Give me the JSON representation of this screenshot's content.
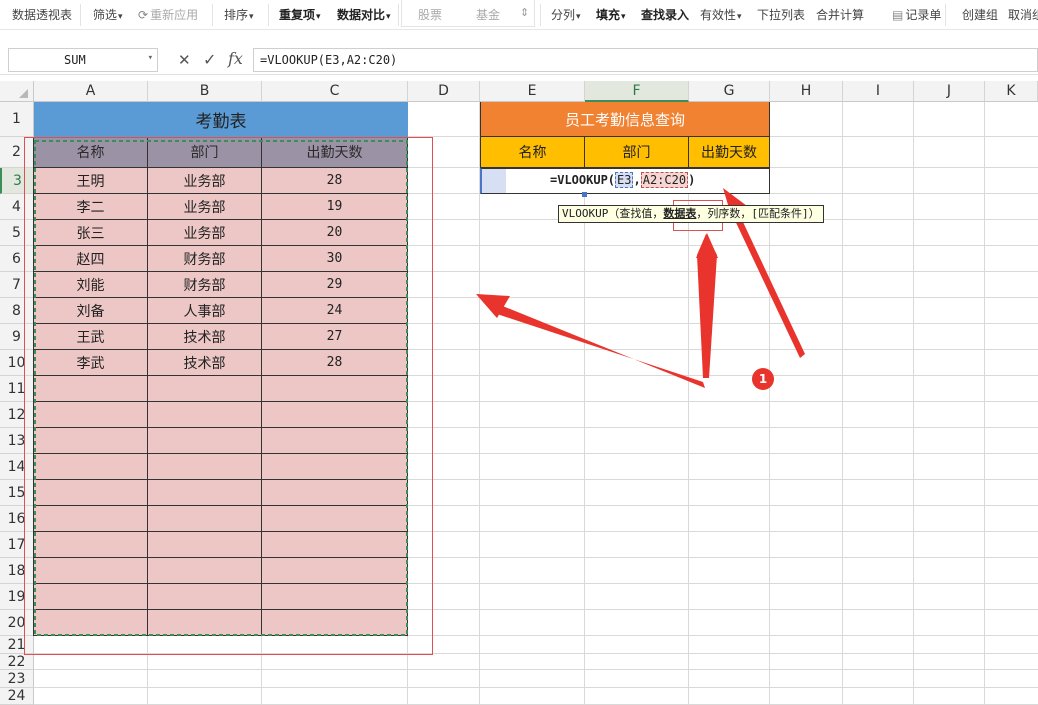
{
  "ribbon": {
    "items": [
      {
        "label": "数据透视表",
        "state": "normal"
      },
      {
        "label": "筛选",
        "state": "normal",
        "dropdown": true
      },
      {
        "label": "重新应用",
        "state": "dim"
      },
      {
        "label": "排序",
        "state": "normal",
        "dropdown": true
      },
      {
        "label": "重复项",
        "state": "bold",
        "dropdown": true
      },
      {
        "label": "数据对比",
        "state": "bold",
        "dropdown": true
      },
      {
        "label": "股票",
        "state": "dim"
      },
      {
        "label": "基金",
        "state": "dim"
      },
      {
        "label": "分列",
        "state": "normal",
        "dropdown": true
      },
      {
        "label": "填充",
        "state": "bold",
        "dropdown": true
      },
      {
        "label": "查找录入",
        "state": "bold"
      },
      {
        "label": "有效性",
        "state": "normal",
        "dropdown": true
      },
      {
        "label": "下拉列表",
        "state": "normal"
      },
      {
        "label": "合并计算",
        "state": "normal"
      },
      {
        "label": "记录单",
        "state": "normal"
      },
      {
        "label": "创建组",
        "state": "normal"
      },
      {
        "label": "取消组",
        "state": "normal"
      }
    ]
  },
  "formula_bar": {
    "name_box": "SUM",
    "cancel_symbol": "✕",
    "confirm_symbol": "✓",
    "fx_label": "fx",
    "formula": "=VLOOKUP(E3,A2:C20)"
  },
  "columns": [
    "A",
    "B",
    "C",
    "D",
    "E",
    "F",
    "G",
    "H",
    "I",
    "J",
    "K"
  ],
  "rows": [
    "1",
    "2",
    "3",
    "4",
    "5",
    "6",
    "7",
    "8",
    "9",
    "10",
    "11",
    "12",
    "13",
    "14",
    "15",
    "16",
    "17",
    "18",
    "19",
    "20",
    "21",
    "22",
    "23",
    "24"
  ],
  "selected_column": "F",
  "selected_row": "3",
  "attendance_table": {
    "title": "考勤表",
    "headers": [
      "名称",
      "部门",
      "出勤天数"
    ],
    "rows": [
      [
        "王明",
        "业务部",
        "28"
      ],
      [
        "李二",
        "业务部",
        "19"
      ],
      [
        "张三",
        "业务部",
        "20"
      ],
      [
        "赵四",
        "财务部",
        "30"
      ],
      [
        "刘能",
        "财务部",
        "29"
      ],
      [
        "刘备",
        "人事部",
        "24"
      ],
      [
        "王武",
        "技术部",
        "27"
      ],
      [
        "李武",
        "技术部",
        "28"
      ]
    ]
  },
  "query_table": {
    "title": "员工考勤信息查询",
    "headers": [
      "名称",
      "部门",
      "出勤天数"
    ],
    "editing_formula": {
      "prefix": "=VLOOKUP(",
      "arg1": "E3",
      "sep": ",",
      "arg2": "A2:C20",
      "suffix": ")"
    }
  },
  "tooltip": {
    "prefix": "VLOOKUP（查找值，",
    "current_arg": "数据表",
    "suffix": "，列序数，[匹配条件]）"
  },
  "annotation": {
    "step_number": "1"
  },
  "colors": {
    "table_title_bg": "#5b9bd5",
    "table_header_bg": "#9b92a6",
    "table_body_bg": "#ecc7c5",
    "query_title_bg": "#f08232",
    "query_header_bg": "#ffbe00",
    "arrow_red": "#e8342c",
    "marquee_green": "#3c8d5a"
  }
}
